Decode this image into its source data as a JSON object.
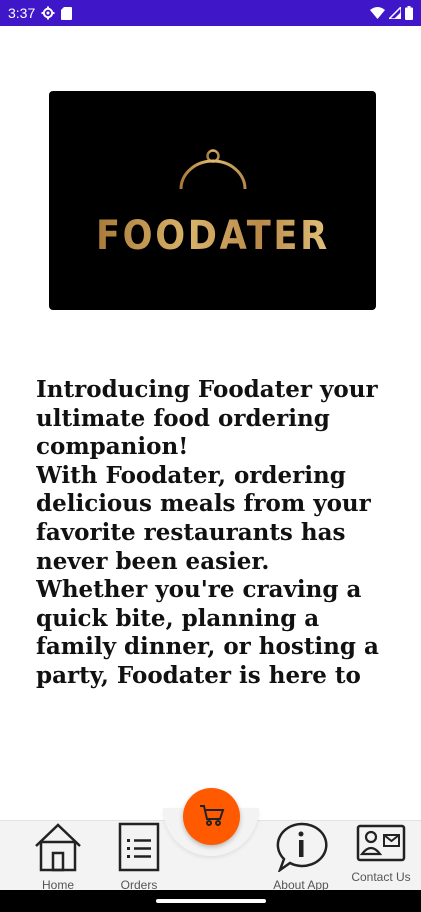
{
  "status_bar": {
    "time": "3:37",
    "icons": [
      "settings-icon",
      "sd-card-icon",
      "wifi-icon",
      "cell-signal-icon",
      "battery-icon"
    ]
  },
  "logo": {
    "wordmark": "FOODATER",
    "icon": "cloche-icon",
    "colors": {
      "background": "#000000",
      "gold": "#c9a05a"
    }
  },
  "intro": {
    "text": "Introducing Foodater  your ultimate food ordering companion!\n With Foodater, ordering delicious meals from your favorite restaurants has never been easier.\n Whether you're craving a quick bite, planning a family dinner, or hosting a party, Foodater is here to make it happen."
  },
  "bottom_nav": {
    "items": [
      {
        "label": "Home",
        "icon": "home-icon"
      },
      {
        "label": "Orders",
        "icon": "orders-list-icon"
      },
      {
        "label": "About App",
        "icon": "info-bubble-icon"
      },
      {
        "label": "Contact Us",
        "icon": "contact-card-icon"
      }
    ],
    "fab": {
      "icon": "cart-icon",
      "color": "#ff5a00"
    }
  },
  "colors": {
    "status_bar": "#3f17c8",
    "nav_background": "#f3f3f3"
  }
}
